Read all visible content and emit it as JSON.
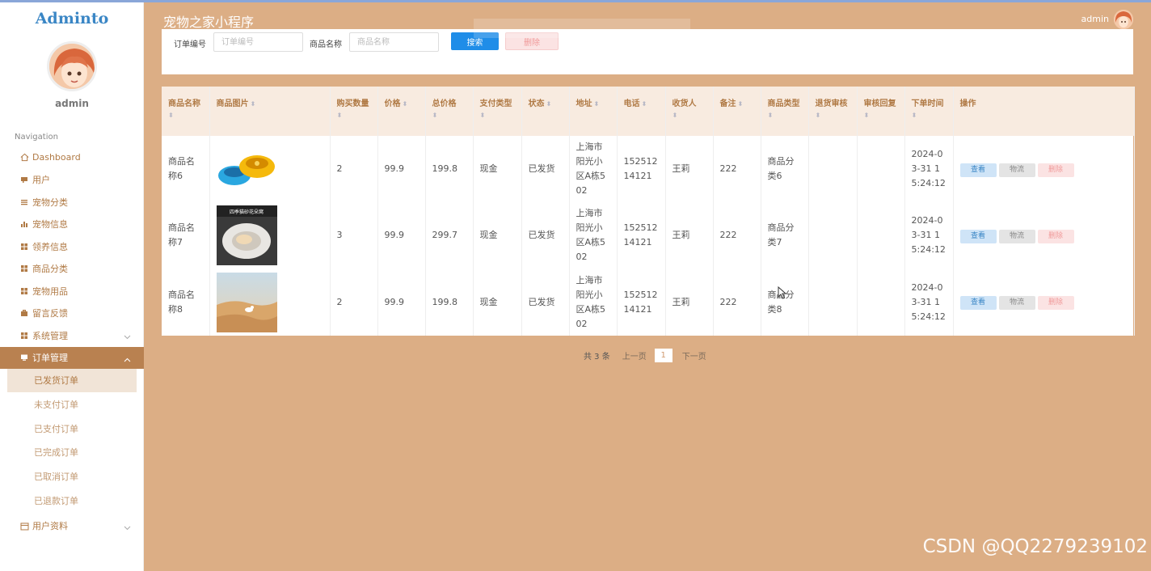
{
  "sidebar": {
    "logo": "Adminto",
    "username": "admin",
    "nav_title": "Navigation",
    "items": [
      {
        "label": "Dashboard",
        "icon": "home-icon"
      },
      {
        "label": "用户",
        "icon": "user-icon"
      },
      {
        "label": "宠物分类",
        "icon": "list-icon"
      },
      {
        "label": "宠物信息",
        "icon": "chart-icon"
      },
      {
        "label": "领养信息",
        "icon": "grid-icon"
      },
      {
        "label": "商品分类",
        "icon": "grid-icon"
      },
      {
        "label": "宠物用品",
        "icon": "grid-icon"
      },
      {
        "label": "留言反馈",
        "icon": "briefcase-icon"
      },
      {
        "label": "系统管理",
        "icon": "grid-icon"
      },
      {
        "label": "订单管理",
        "icon": "monitor-icon"
      },
      {
        "label": "用户资料",
        "icon": "calendar-icon"
      }
    ],
    "order_submenu": [
      "已发货订单",
      "未支付订单",
      "已支付订单",
      "已完成订单",
      "已取消订单",
      "已退款订单"
    ]
  },
  "header": {
    "title": "宠物之家小程序",
    "user": "admin"
  },
  "search": {
    "order_no_label": "订单编号",
    "order_no_placeholder": "订单编号",
    "product_label": "商品名称",
    "product_placeholder": "商品名称",
    "search_button": "搜索",
    "delete_button": "删除"
  },
  "table": {
    "columns": [
      "商品名称",
      "商品图片",
      "购买数量",
      "价格",
      "总价格",
      "支付类型",
      "状态",
      "地址",
      "电话",
      "收货人",
      "备注",
      "商品类型",
      "退货审核",
      "审核回复",
      "下单时间",
      "操作"
    ],
    "rows": [
      {
        "name": "商品名称6",
        "image": "pet-bowl-image",
        "qty": "2",
        "price": "99.9",
        "total": "199.8",
        "pay": "现金",
        "status": "已发货",
        "address": "上海市阳光小区A栋502",
        "phone": "15251214121",
        "receiver": "王莉",
        "note": "222",
        "type": "商品分类6",
        "return_review": "",
        "reply": "",
        "time": "2024-03-31 15:24:12"
      },
      {
        "name": "商品名称7",
        "image": "cat-bed-image",
        "image_caption": "四季猫砂花朵窝",
        "qty": "3",
        "price": "99.9",
        "total": "299.7",
        "pay": "现金",
        "status": "已发货",
        "address": "上海市阳光小区A栋502",
        "phone": "15251214121",
        "receiver": "王莉",
        "note": "222",
        "type": "商品分类7",
        "return_review": "",
        "reply": "",
        "time": "2024-03-31 15:24:12"
      },
      {
        "name": "商品名称8",
        "image": "desert-dog-image",
        "qty": "2",
        "price": "99.9",
        "total": "199.8",
        "pay": "现金",
        "status": "已发货",
        "address": "上海市阳光小区A栋502",
        "phone": "15251214121",
        "receiver": "王莉",
        "note": "222",
        "type": "商品分类8",
        "return_review": "",
        "reply": "",
        "time": "2024-03-31 15:24:12"
      }
    ],
    "actions": {
      "view": "查看",
      "ship": "物流",
      "delete": "删除"
    }
  },
  "pagination": {
    "total": "共 3 条",
    "prev": "上一页",
    "page": "1",
    "next": "下一页"
  },
  "watermark": "CSDN @QQ2279239102",
  "colors": {
    "brand": "#dcae85",
    "active_menu": "#b98150",
    "primary_button": "#1f8de8"
  }
}
